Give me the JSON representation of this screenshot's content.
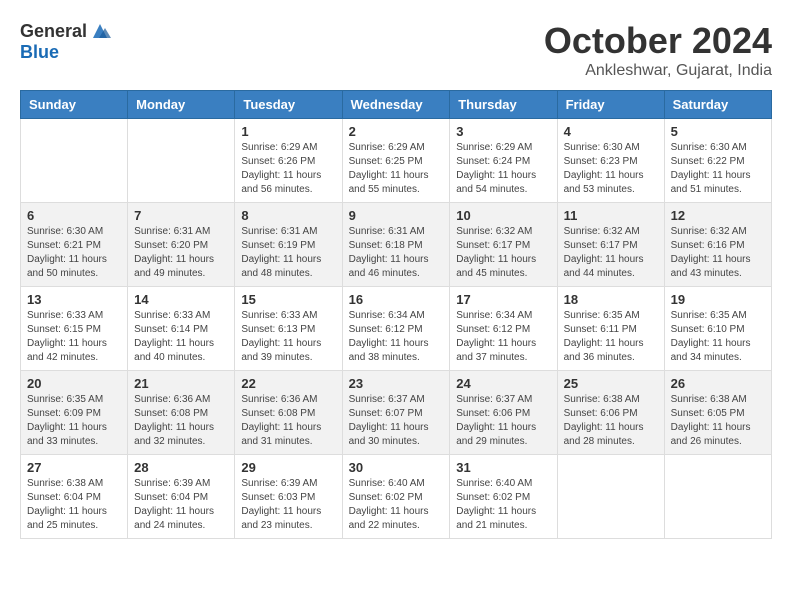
{
  "header": {
    "logo_general": "General",
    "logo_blue": "Blue",
    "month": "October 2024",
    "location": "Ankleshwar, Gujarat, India"
  },
  "days_of_week": [
    "Sunday",
    "Monday",
    "Tuesday",
    "Wednesday",
    "Thursday",
    "Friday",
    "Saturday"
  ],
  "weeks": [
    [
      {
        "day": "",
        "sunrise": "",
        "sunset": "",
        "daylight": ""
      },
      {
        "day": "",
        "sunrise": "",
        "sunset": "",
        "daylight": ""
      },
      {
        "day": "1",
        "sunrise": "Sunrise: 6:29 AM",
        "sunset": "Sunset: 6:26 PM",
        "daylight": "Daylight: 11 hours and 56 minutes."
      },
      {
        "day": "2",
        "sunrise": "Sunrise: 6:29 AM",
        "sunset": "Sunset: 6:25 PM",
        "daylight": "Daylight: 11 hours and 55 minutes."
      },
      {
        "day": "3",
        "sunrise": "Sunrise: 6:29 AM",
        "sunset": "Sunset: 6:24 PM",
        "daylight": "Daylight: 11 hours and 54 minutes."
      },
      {
        "day": "4",
        "sunrise": "Sunrise: 6:30 AM",
        "sunset": "Sunset: 6:23 PM",
        "daylight": "Daylight: 11 hours and 53 minutes."
      },
      {
        "day": "5",
        "sunrise": "Sunrise: 6:30 AM",
        "sunset": "Sunset: 6:22 PM",
        "daylight": "Daylight: 11 hours and 51 minutes."
      }
    ],
    [
      {
        "day": "6",
        "sunrise": "Sunrise: 6:30 AM",
        "sunset": "Sunset: 6:21 PM",
        "daylight": "Daylight: 11 hours and 50 minutes."
      },
      {
        "day": "7",
        "sunrise": "Sunrise: 6:31 AM",
        "sunset": "Sunset: 6:20 PM",
        "daylight": "Daylight: 11 hours and 49 minutes."
      },
      {
        "day": "8",
        "sunrise": "Sunrise: 6:31 AM",
        "sunset": "Sunset: 6:19 PM",
        "daylight": "Daylight: 11 hours and 48 minutes."
      },
      {
        "day": "9",
        "sunrise": "Sunrise: 6:31 AM",
        "sunset": "Sunset: 6:18 PM",
        "daylight": "Daylight: 11 hours and 46 minutes."
      },
      {
        "day": "10",
        "sunrise": "Sunrise: 6:32 AM",
        "sunset": "Sunset: 6:17 PM",
        "daylight": "Daylight: 11 hours and 45 minutes."
      },
      {
        "day": "11",
        "sunrise": "Sunrise: 6:32 AM",
        "sunset": "Sunset: 6:17 PM",
        "daylight": "Daylight: 11 hours and 44 minutes."
      },
      {
        "day": "12",
        "sunrise": "Sunrise: 6:32 AM",
        "sunset": "Sunset: 6:16 PM",
        "daylight": "Daylight: 11 hours and 43 minutes."
      }
    ],
    [
      {
        "day": "13",
        "sunrise": "Sunrise: 6:33 AM",
        "sunset": "Sunset: 6:15 PM",
        "daylight": "Daylight: 11 hours and 42 minutes."
      },
      {
        "day": "14",
        "sunrise": "Sunrise: 6:33 AM",
        "sunset": "Sunset: 6:14 PM",
        "daylight": "Daylight: 11 hours and 40 minutes."
      },
      {
        "day": "15",
        "sunrise": "Sunrise: 6:33 AM",
        "sunset": "Sunset: 6:13 PM",
        "daylight": "Daylight: 11 hours and 39 minutes."
      },
      {
        "day": "16",
        "sunrise": "Sunrise: 6:34 AM",
        "sunset": "Sunset: 6:12 PM",
        "daylight": "Daylight: 11 hours and 38 minutes."
      },
      {
        "day": "17",
        "sunrise": "Sunrise: 6:34 AM",
        "sunset": "Sunset: 6:12 PM",
        "daylight": "Daylight: 11 hours and 37 minutes."
      },
      {
        "day": "18",
        "sunrise": "Sunrise: 6:35 AM",
        "sunset": "Sunset: 6:11 PM",
        "daylight": "Daylight: 11 hours and 36 minutes."
      },
      {
        "day": "19",
        "sunrise": "Sunrise: 6:35 AM",
        "sunset": "Sunset: 6:10 PM",
        "daylight": "Daylight: 11 hours and 34 minutes."
      }
    ],
    [
      {
        "day": "20",
        "sunrise": "Sunrise: 6:35 AM",
        "sunset": "Sunset: 6:09 PM",
        "daylight": "Daylight: 11 hours and 33 minutes."
      },
      {
        "day": "21",
        "sunrise": "Sunrise: 6:36 AM",
        "sunset": "Sunset: 6:08 PM",
        "daylight": "Daylight: 11 hours and 32 minutes."
      },
      {
        "day": "22",
        "sunrise": "Sunrise: 6:36 AM",
        "sunset": "Sunset: 6:08 PM",
        "daylight": "Daylight: 11 hours and 31 minutes."
      },
      {
        "day": "23",
        "sunrise": "Sunrise: 6:37 AM",
        "sunset": "Sunset: 6:07 PM",
        "daylight": "Daylight: 11 hours and 30 minutes."
      },
      {
        "day": "24",
        "sunrise": "Sunrise: 6:37 AM",
        "sunset": "Sunset: 6:06 PM",
        "daylight": "Daylight: 11 hours and 29 minutes."
      },
      {
        "day": "25",
        "sunrise": "Sunrise: 6:38 AM",
        "sunset": "Sunset: 6:06 PM",
        "daylight": "Daylight: 11 hours and 28 minutes."
      },
      {
        "day": "26",
        "sunrise": "Sunrise: 6:38 AM",
        "sunset": "Sunset: 6:05 PM",
        "daylight": "Daylight: 11 hours and 26 minutes."
      }
    ],
    [
      {
        "day": "27",
        "sunrise": "Sunrise: 6:38 AM",
        "sunset": "Sunset: 6:04 PM",
        "daylight": "Daylight: 11 hours and 25 minutes."
      },
      {
        "day": "28",
        "sunrise": "Sunrise: 6:39 AM",
        "sunset": "Sunset: 6:04 PM",
        "daylight": "Daylight: 11 hours and 24 minutes."
      },
      {
        "day": "29",
        "sunrise": "Sunrise: 6:39 AM",
        "sunset": "Sunset: 6:03 PM",
        "daylight": "Daylight: 11 hours and 23 minutes."
      },
      {
        "day": "30",
        "sunrise": "Sunrise: 6:40 AM",
        "sunset": "Sunset: 6:02 PM",
        "daylight": "Daylight: 11 hours and 22 minutes."
      },
      {
        "day": "31",
        "sunrise": "Sunrise: 6:40 AM",
        "sunset": "Sunset: 6:02 PM",
        "daylight": "Daylight: 11 hours and 21 minutes."
      },
      {
        "day": "",
        "sunrise": "",
        "sunset": "",
        "daylight": ""
      },
      {
        "day": "",
        "sunrise": "",
        "sunset": "",
        "daylight": ""
      }
    ]
  ]
}
